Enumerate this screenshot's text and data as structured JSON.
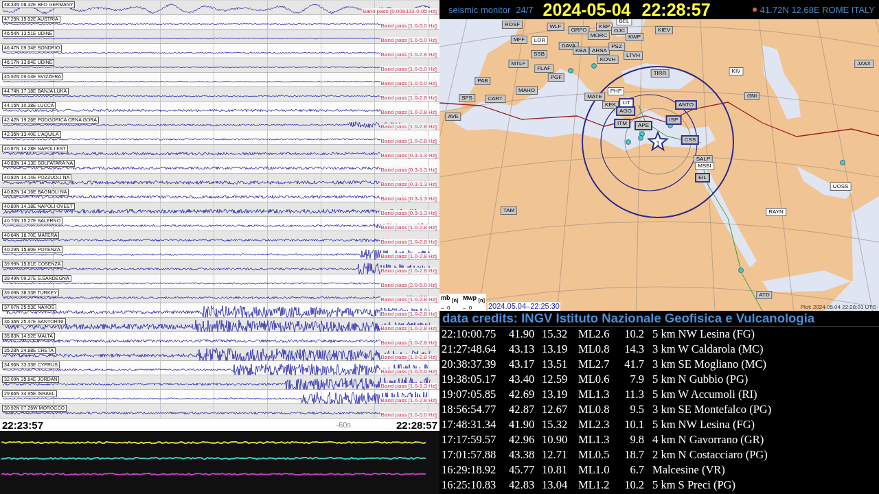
{
  "traces": [
    {
      "label": "48.33N 08.32E BFO GERMANY",
      "filter": "Band pass [0.008333-0.05 Hz]"
    },
    {
      "label": "47.25N 15.52E AUSTRIA",
      "filter": "Band pass [1.0-5.0 Hz]"
    },
    {
      "label": "46.54N 13.51E UDINE",
      "filter": "Band pass [1.0-5.0 Hz]"
    },
    {
      "label": "46.47N 09.34E SONDRIO",
      "filter": "Band pass [1.0-2.8 Hz]"
    },
    {
      "label": "46.17N 13.64E UDINE",
      "filter": "Band pass [1.0-5.0 Hz]"
    },
    {
      "label": "45.92N 09.04E SVIZZERA",
      "filter": "Band pass [1.0-5.0 Hz]"
    },
    {
      "label": "44.74N 17.18E BANJA LUKA",
      "filter": "Band pass [1.0-2.8 Hz]"
    },
    {
      "label": "44.15N 10.38E LUCCA",
      "filter": "Band pass [1.0-2.8 Hz]"
    },
    {
      "label": "42.42N 19.26E PODGORICA CRNA GORA",
      "filter": "Band pass [1.0-2.8 Hz]"
    },
    {
      "label": "42.35N 13.40E L'AQUILA",
      "filter": "Band pass [1.0-2.8 Hz]"
    },
    {
      "label": "40.87N 14.28E NAPOLI EST",
      "filter": "Band pass [0.3-1.3 Hz]"
    },
    {
      "label": "40.83N 14.13E SOLFATARA NA",
      "filter": "Band pass [0.3-1.3 Hz]"
    },
    {
      "label": "40.82N 14.14E POZZUOLI NA",
      "filter": "Band pass [0.3-1.3 Hz]"
    },
    {
      "label": "40.82N 14.16E BAGNOLI NA",
      "filter": "Band pass [0.3-1.3 Hz]"
    },
    {
      "label": "40.80N 14.18E NAPOLI OVEST",
      "filter": "Band pass [0.3-1.3 Hz]"
    },
    {
      "label": "40.70N 15.27E SALERNO",
      "filter": "Band pass [1.0-2.8 Hz]"
    },
    {
      "label": "40.64N 16.70E MATERA",
      "filter": "Band pass [1.0-2.8 Hz]"
    },
    {
      "label": "40.29N 15.80E POTENZA",
      "filter": "Band pass [1.0-2.8 Hz]"
    },
    {
      "label": "39.99N 15.81E COSENZA",
      "filter": "Band pass [1.0-2.8 Hz]"
    },
    {
      "label": "39.49N 09.37E S.SARDEGNA",
      "filter": "Band pass [2.0-5.0 Hz]"
    },
    {
      "label": "39.09N 38.33E TURKEY",
      "filter": "Band pass [1.0-2.8 Hz]"
    },
    {
      "label": "37.07N 25.53E NAXOS",
      "filter": "Band pass [1.0-2.8 Hz]"
    },
    {
      "label": "36.36N 25.47E SANTORINI",
      "filter": "Band pass [1.0-2.8 Hz]"
    },
    {
      "label": "35.83N 14.52E MALTA",
      "filter": "Band pass [1.0-2.8 Hz]"
    },
    {
      "label": "35.28N 24.88E CRETA",
      "filter": "Band pass [1.0-2.8 Hz]"
    },
    {
      "label": "34.96N 33.33E CYPRUS",
      "filter": "Band pass [1.0-5.0 Hz]"
    },
    {
      "label": "32.09N 35.64E JORDAN",
      "filter": "Band pass [1.0-1.3 Hz]"
    },
    {
      "label": "29.66N 34.95E ISRAEL",
      "filter": "Band pass [1.0-2.8 Hz]"
    },
    {
      "label": "30.92N 07.26W MOROCCO",
      "filter": "Band pass [1.0-5.0 Hz]"
    }
  ],
  "time_axis": {
    "start": "22:23:57",
    "marker": "-60s",
    "end": "22:28:57"
  },
  "bottom_traces": [
    {
      "color": "#d8d840"
    },
    {
      "color": "#40d0c0"
    },
    {
      "color": "#c040c0"
    }
  ],
  "header": {
    "app": "seismic monitor",
    "schedule": "24/7",
    "date": "2024-05-04",
    "time": "22:28:57",
    "location": "41.72N 12.68E ROME ITALY"
  },
  "map": {
    "stations": [
      {
        "code": "ROSF",
        "kind": "gray"
      },
      {
        "code": "WLF",
        "kind": "gray"
      },
      {
        "code": "GRFO",
        "kind": "gray"
      },
      {
        "code": "KSP",
        "kind": "gray"
      },
      {
        "code": "BEL",
        "kind": "white"
      },
      {
        "code": "MORC",
        "kind": "gray"
      },
      {
        "code": "OJC",
        "kind": "gray"
      },
      {
        "code": "KWP",
        "kind": "gray"
      },
      {
        "code": "KIEV",
        "kind": "gray"
      },
      {
        "code": "MFF",
        "kind": "gray"
      },
      {
        "code": "LOR",
        "kind": "white"
      },
      {
        "code": "DAVA",
        "kind": "gray"
      },
      {
        "code": "KBA",
        "kind": "gray"
      },
      {
        "code": "ARSA",
        "kind": "gray"
      },
      {
        "code": "PSZ",
        "kind": "gray"
      },
      {
        "code": "LTVH",
        "kind": "gray"
      },
      {
        "code": "SSB",
        "kind": "gray"
      },
      {
        "code": "KOVH",
        "kind": "gray"
      },
      {
        "code": "FLAF",
        "kind": "gray"
      },
      {
        "code": "PGF",
        "kind": "gray"
      },
      {
        "code": "MTLF",
        "kind": "gray"
      },
      {
        "code": "PAB",
        "kind": "gray"
      },
      {
        "code": "MAHO",
        "kind": "gray"
      },
      {
        "code": "SFS",
        "kind": "gray"
      },
      {
        "code": "CART",
        "kind": "gray"
      },
      {
        "code": "AVE",
        "kind": "gray"
      },
      {
        "code": "TIRR",
        "kind": "gray"
      },
      {
        "code": "KIV",
        "kind": "white"
      },
      {
        "code": "JZAX",
        "kind": "gray"
      },
      {
        "code": "PHP",
        "kind": "white"
      },
      {
        "code": "MATE",
        "kind": "gray"
      },
      {
        "code": "KEK",
        "kind": "gray"
      },
      {
        "code": "LIT",
        "kind": "active-white"
      },
      {
        "code": "AGG",
        "kind": "active"
      },
      {
        "code": "ANTO",
        "kind": "active"
      },
      {
        "code": "GNI",
        "kind": "gray"
      },
      {
        "code": "ITM",
        "kind": "active"
      },
      {
        "code": "APE",
        "kind": "active"
      },
      {
        "code": "ISP",
        "kind": "active"
      },
      {
        "code": "CSS",
        "kind": "active"
      },
      {
        "code": "SALP",
        "kind": "gray"
      },
      {
        "code": "MSBI",
        "kind": "white"
      },
      {
        "code": "EIL",
        "kind": "active"
      },
      {
        "code": "UOSS",
        "kind": "white"
      },
      {
        "code": "TAM",
        "kind": "gray"
      },
      {
        "code": "RAYN",
        "kind": "white"
      },
      {
        "code": "ATD",
        "kind": "gray"
      }
    ],
    "epicenter_label": "1",
    "legend": {
      "mb": "mb $_{[n]}$",
      "mwp": "Mwp $_{[n]}$",
      "mb_count": "–  0",
      "mwp_count": "–  0"
    },
    "event_time": "2024.05.04–22:25:30",
    "plot_time": "Plot: 2024.05.04 22:28:01 UTC"
  },
  "credits": "data credits: INGV Istituto Nazionale Geofisica e Vulcanologia",
  "events": [
    {
      "time": "22:10:00.75",
      "lat": "41.90",
      "lon": "15.32",
      "mag": "ML2.6",
      "depth": "10.2",
      "location": "5 km NW Lesina (FG)"
    },
    {
      "time": "21:27:48.64",
      "lat": "43.13",
      "lon": "13.19",
      "mag": "ML0.8",
      "depth": "14.3",
      "location": "3 km W Caldarola (MC)"
    },
    {
      "time": "20:38:37.39",
      "lat": "43.17",
      "lon": "13.51",
      "mag": "ML2.7",
      "depth": "41.7",
      "location": "3 km SE Mogliano (MC)"
    },
    {
      "time": "19:38:05.17",
      "lat": "43.40",
      "lon": "12.59",
      "mag": "ML0.6",
      "depth": "7.9",
      "location": "5 km N Gubbio (PG)"
    },
    {
      "time": "19:07:05.85",
      "lat": "42.69",
      "lon": "13.19",
      "mag": "ML1.3",
      "depth": "11.3",
      "location": "5 km W Accumoli (RI)"
    },
    {
      "time": "18:56:54.77",
      "lat": "42.87",
      "lon": "12.67",
      "mag": "ML0.8",
      "depth": "9.5",
      "location": "3 km SE Montefalco (PG)"
    },
    {
      "time": "17:48:31.34",
      "lat": "41.90",
      "lon": "15.32",
      "mag": "ML2.3",
      "depth": "10.1",
      "location": "5 km NW Lesina (FG)"
    },
    {
      "time": "17:17:59.57",
      "lat": "42.96",
      "lon": "10.90",
      "mag": "ML1.3",
      "depth": "9.8",
      "location": "4 km N Gavorrano (GR)"
    },
    {
      "time": "17:01:57.88",
      "lat": "43.38",
      "lon": "12.71",
      "mag": "ML0.5",
      "depth": "18.7",
      "location": "2 km N Costacciaro (PG)"
    },
    {
      "time": "16:29:18.92",
      "lat": "45.77",
      "lon": "10.81",
      "mag": "ML1.0",
      "depth": "6.7",
      "location": "Malcesine (VR)"
    },
    {
      "time": "16:25:10.83",
      "lat": "42.83",
      "lon": "13.04",
      "mag": "ML1.2",
      "depth": "10.2",
      "location": "5 km S Preci (PG)"
    }
  ]
}
